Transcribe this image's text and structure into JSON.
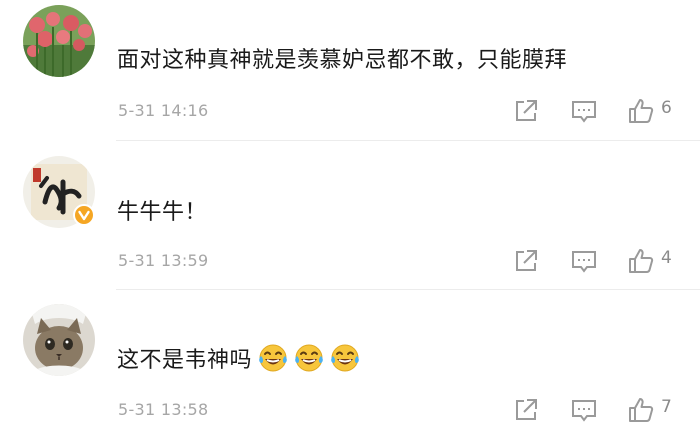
{
  "comments": [
    {
      "avatar": "tulip-field-avatar",
      "text": "面对这种真神就是羡慕妒忌都不敢，只能膜拜",
      "time": "5-31 14:16",
      "likes": "6"
    },
    {
      "avatar": "calligraphy-avatar",
      "verified": true,
      "text": "牛牛牛！",
      "time": "5-31 13:59",
      "likes": "4"
    },
    {
      "avatar": "cat-avatar",
      "text": "这不是韦神吗",
      "emoji_count": 3,
      "emoji": "laughing-crying-emoji",
      "time": "5-31 13:58",
      "likes": "7"
    }
  ],
  "colors": {
    "text": "#1a1a1a",
    "meta": "#a6a6a6",
    "icon": "#9a9a9a",
    "verified": "#f5a623",
    "emoji_face": "#f7c63c"
  }
}
